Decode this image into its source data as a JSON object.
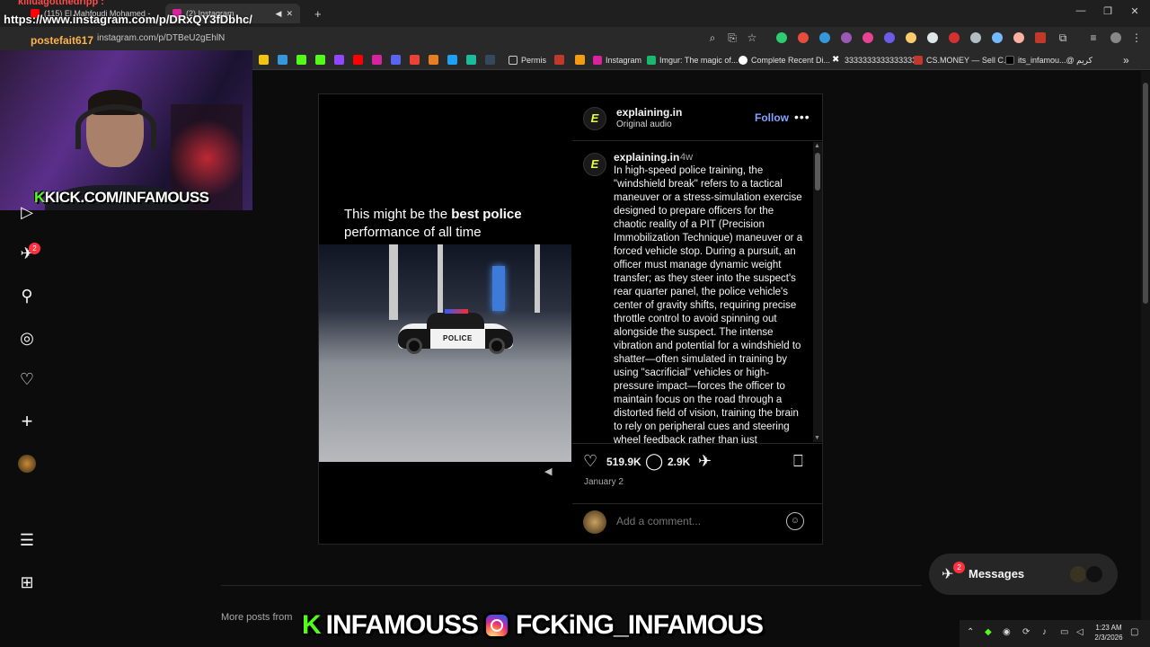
{
  "browser": {
    "tabs": [
      {
        "label": "(115) El Mahfoudi Mohamed -"
      },
      {
        "label": "(2) Instagram"
      }
    ],
    "new_tab": "+",
    "url": "instagram.com/p/DTBeU2gEhlN",
    "bookmarks": [
      {
        "label": "Permis"
      },
      {
        "label": "Instagram"
      },
      {
        "label": "Imgur: The magic of..."
      },
      {
        "label": "Complete Recent Di..."
      },
      {
        "label": "3333333333333333"
      },
      {
        "label": "CS.MONEY — Sell C..."
      },
      {
        "label": "its_infamou...@ كريم"
      }
    ]
  },
  "stream": {
    "chat_line": "kiliuagotthedripp :",
    "link_line": "https://www.instagram.com/p/DRxQY3fDbhc/",
    "username": "postefait617",
    "kick_prefix": "K",
    "kick_handle": "KICK.COM/INFAMOUSS",
    "bottom_kick": "INFAMOUSS",
    "bottom_ig": "FCKiNG_INFAMOUS"
  },
  "nav": {
    "notifications_badge": "2"
  },
  "post": {
    "author": "explaining.in",
    "audio": "Original audio",
    "follow_label": "Follow",
    "more_label": "•••",
    "video_caption_pre": "This might be the ",
    "video_caption_bold": "best police",
    "video_caption_post": " performance of all time",
    "car_label": "POLICE",
    "comment_author": "explaining.in",
    "comment_time": "4w",
    "caption": "In high-speed police training, the \"windshield break\" refers to a tactical maneuver or a stress-simulation exercise designed to prepare officers for the chaotic reality of a PIT (Precision Immobilization Technique) maneuver or a forced vehicle stop.  During a pursuit, an officer must manage dynamic weight transfer; as they steer into the suspect's rear quarter panel, the police vehicle's center of gravity shifts, requiring precise throttle control to avoid spinning out alongside the suspect. The intense vibration and potential for a windshield to shatter—often simulated in training by using \"sacrificial\" vehicles or high-pressure impact—forces the officer to maintain focus on the road through a distorted field of vision, training the brain to rely on peripheral cues and steering wheel feedback rather than just",
    "likes": "519.9K",
    "comments": "2.9K",
    "date": "January 2",
    "comment_placeholder": "Add a comment..."
  },
  "more_posts": "More posts from",
  "messages": {
    "label": "Messages",
    "badge": "2"
  },
  "taskbar": {
    "time": "1:23 AM",
    "date": "2/3/2026"
  }
}
